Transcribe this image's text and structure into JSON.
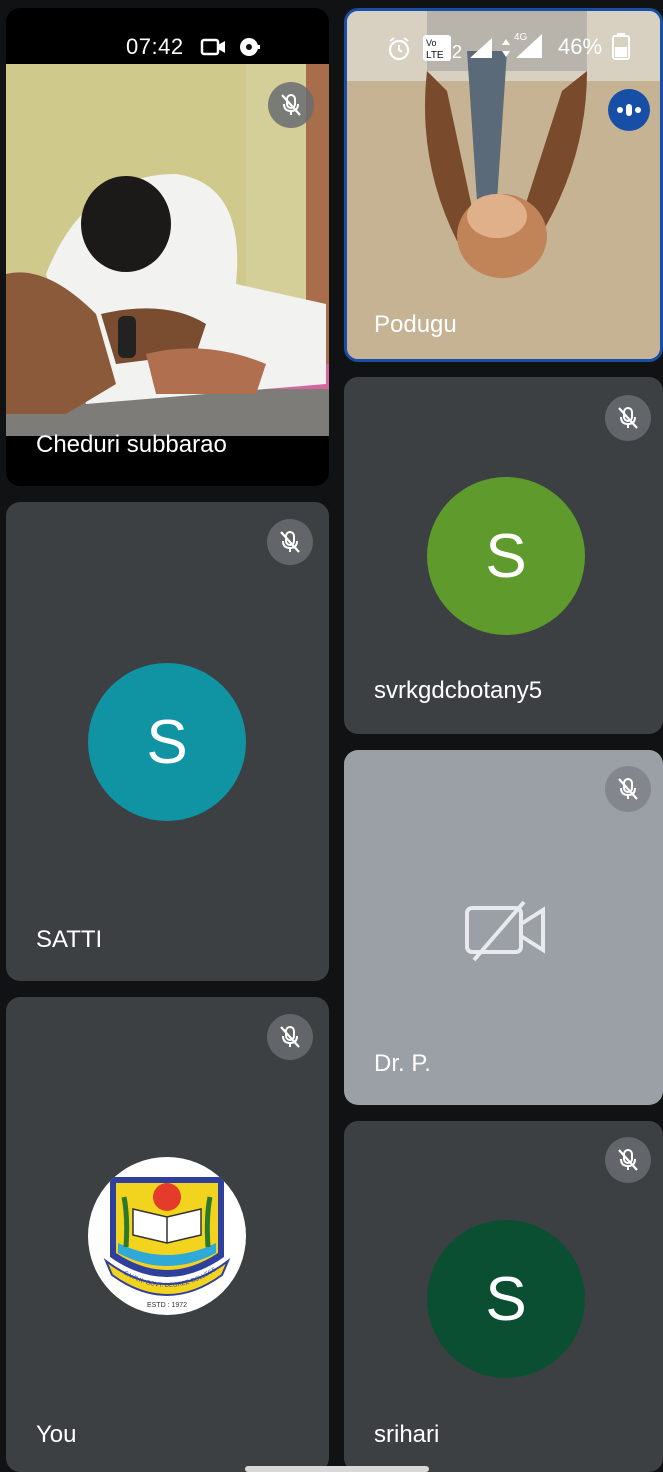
{
  "status_bar": {
    "time": "07:42",
    "network_labels": "Vo LTE2",
    "signal_label": "4G",
    "battery": "46%",
    "icons": [
      "video-recording-icon",
      "cast-icon",
      "alarm-icon",
      "volte-icon",
      "signal-icon",
      "data-arrows-icon",
      "battery-icon"
    ]
  },
  "participants": [
    {
      "id": "cheduri",
      "name": "Cheduri subbarao",
      "type": "video",
      "muted": true
    },
    {
      "id": "podugu",
      "name": "Podugu",
      "type": "video",
      "muted": false,
      "speaking": true,
      "highlight_color": "#174ea6"
    },
    {
      "id": "svrk",
      "name": "svrkgdcbotany5",
      "type": "avatar",
      "initial": "S",
      "avatar_color": "#5f9b2c",
      "muted": true
    },
    {
      "id": "satti",
      "name": "SATTI",
      "type": "avatar",
      "initial": "S",
      "avatar_color": "#1093a3",
      "muted": true
    },
    {
      "id": "drp",
      "name": "Dr. P.",
      "type": "camera-off",
      "tile_color": "#9aa0a6",
      "muted": true
    },
    {
      "id": "you",
      "name": "You",
      "type": "logo",
      "logo_caption": "S.V.R.K. GOVT. DEGREE COLLEGE",
      "logo_estd": "ESTD : 1972",
      "muted": true
    },
    {
      "id": "srihari",
      "name": "srihari",
      "type": "avatar",
      "initial": "S",
      "avatar_color": "#0b4f33",
      "muted": true
    }
  ]
}
